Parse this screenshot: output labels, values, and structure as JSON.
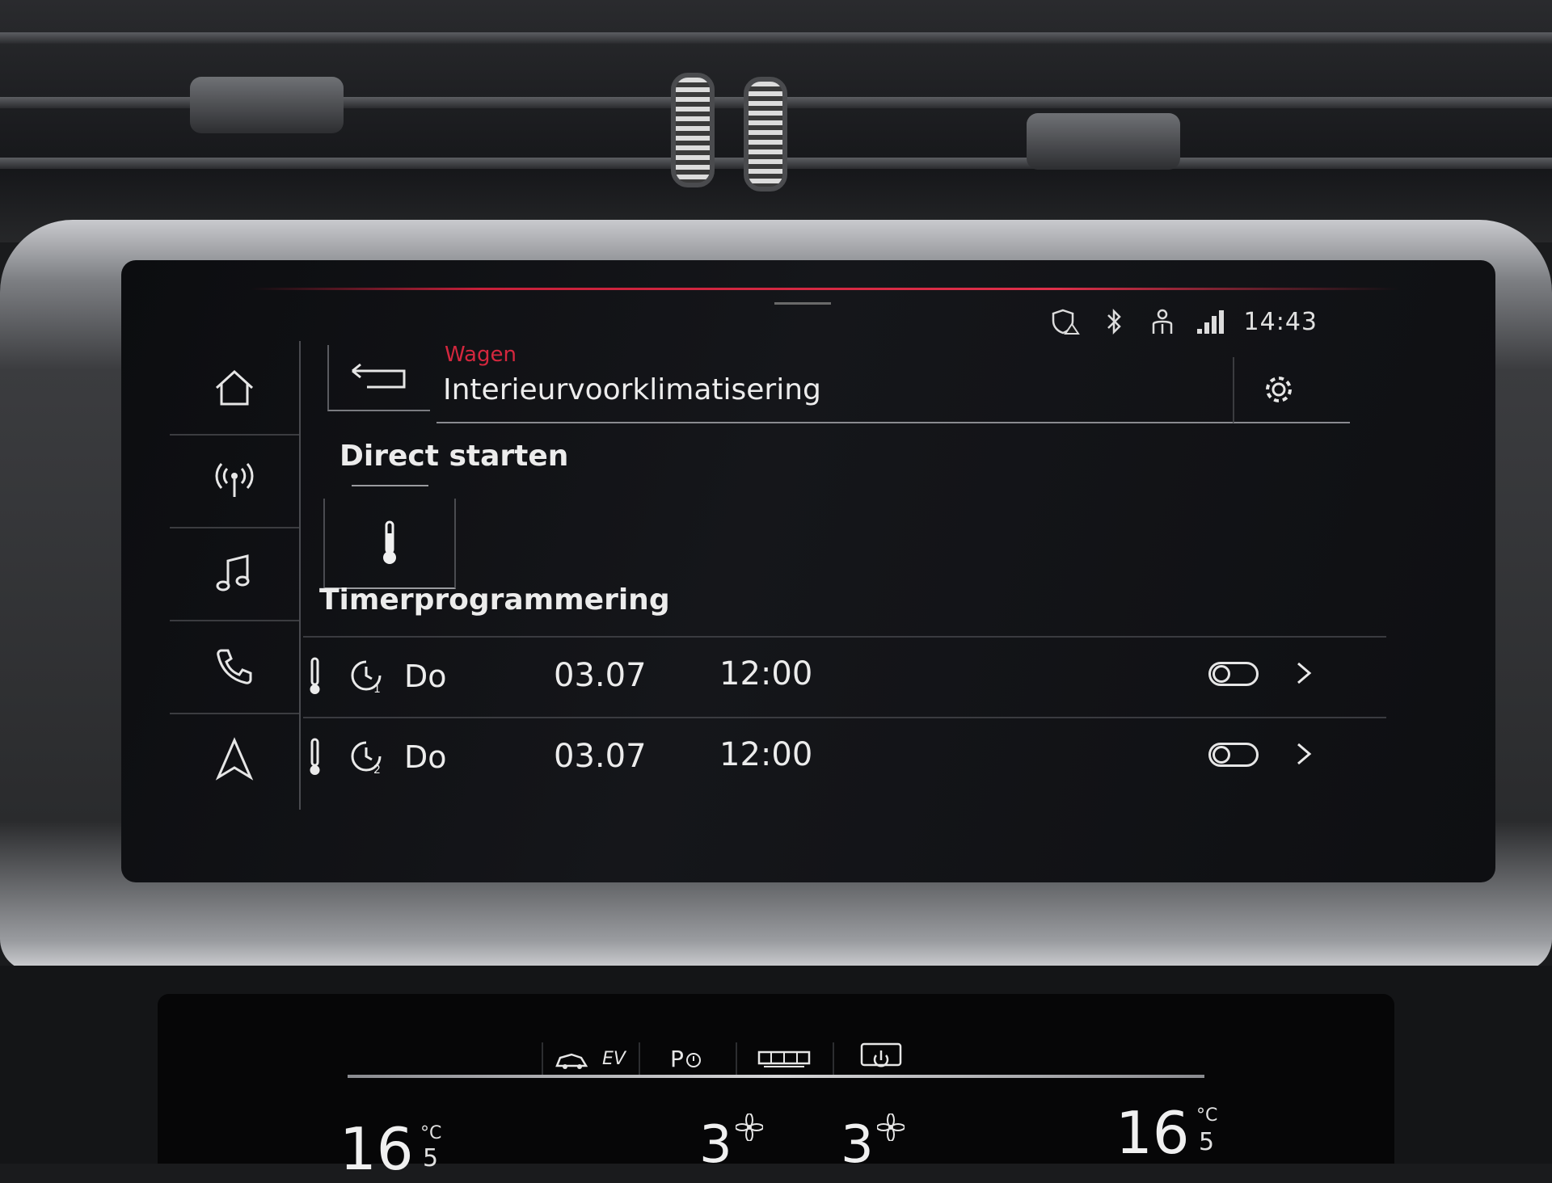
{
  "status": {
    "icons": [
      "shield-warning-icon",
      "bluetooth-icon",
      "person-icon",
      "network-signal-icon"
    ],
    "clock": "14:43"
  },
  "sidebar": {
    "items": [
      {
        "icon": "home-icon"
      },
      {
        "icon": "radio-icon"
      },
      {
        "icon": "music-icon"
      },
      {
        "icon": "phone-icon"
      },
      {
        "icon": "navigation-icon"
      }
    ]
  },
  "header": {
    "breadcrumb": "Wagen",
    "title": "Interieurvoorklimatisering",
    "back_icon": "back-arrow-icon",
    "settings_icon": "gear-icon"
  },
  "direct_start": {
    "heading": "Direct starten",
    "button_icon": "thermometer-icon"
  },
  "timers": {
    "heading": "Timerprogrammering",
    "rows": [
      {
        "timer_number": "1",
        "day": "Do",
        "date": "03.07",
        "time": "12:00",
        "enabled": false
      },
      {
        "timer_number": "2",
        "day": "Do",
        "date": "03.07",
        "time": "12:00",
        "enabled": false
      }
    ]
  },
  "climate": {
    "buttons": [
      {
        "label": "EV",
        "icon": "car-ev-icon"
      },
      {
        "label": "P",
        "icon": "parking-heater-icon"
      },
      {
        "label": "",
        "icon": "rear-window-heater-icon"
      },
      {
        "label": "",
        "icon": "climate-power-icon"
      }
    ],
    "left_temp": {
      "value": "16",
      "decimal": "5",
      "unit": "°C"
    },
    "right_temp": {
      "value": "16",
      "decimal": "5",
      "unit": "°C"
    },
    "left_fan": "3",
    "right_fan": "3"
  },
  "colors": {
    "accent": "#d4273e",
    "text": "#ececec",
    "background": "#0e0f12"
  }
}
